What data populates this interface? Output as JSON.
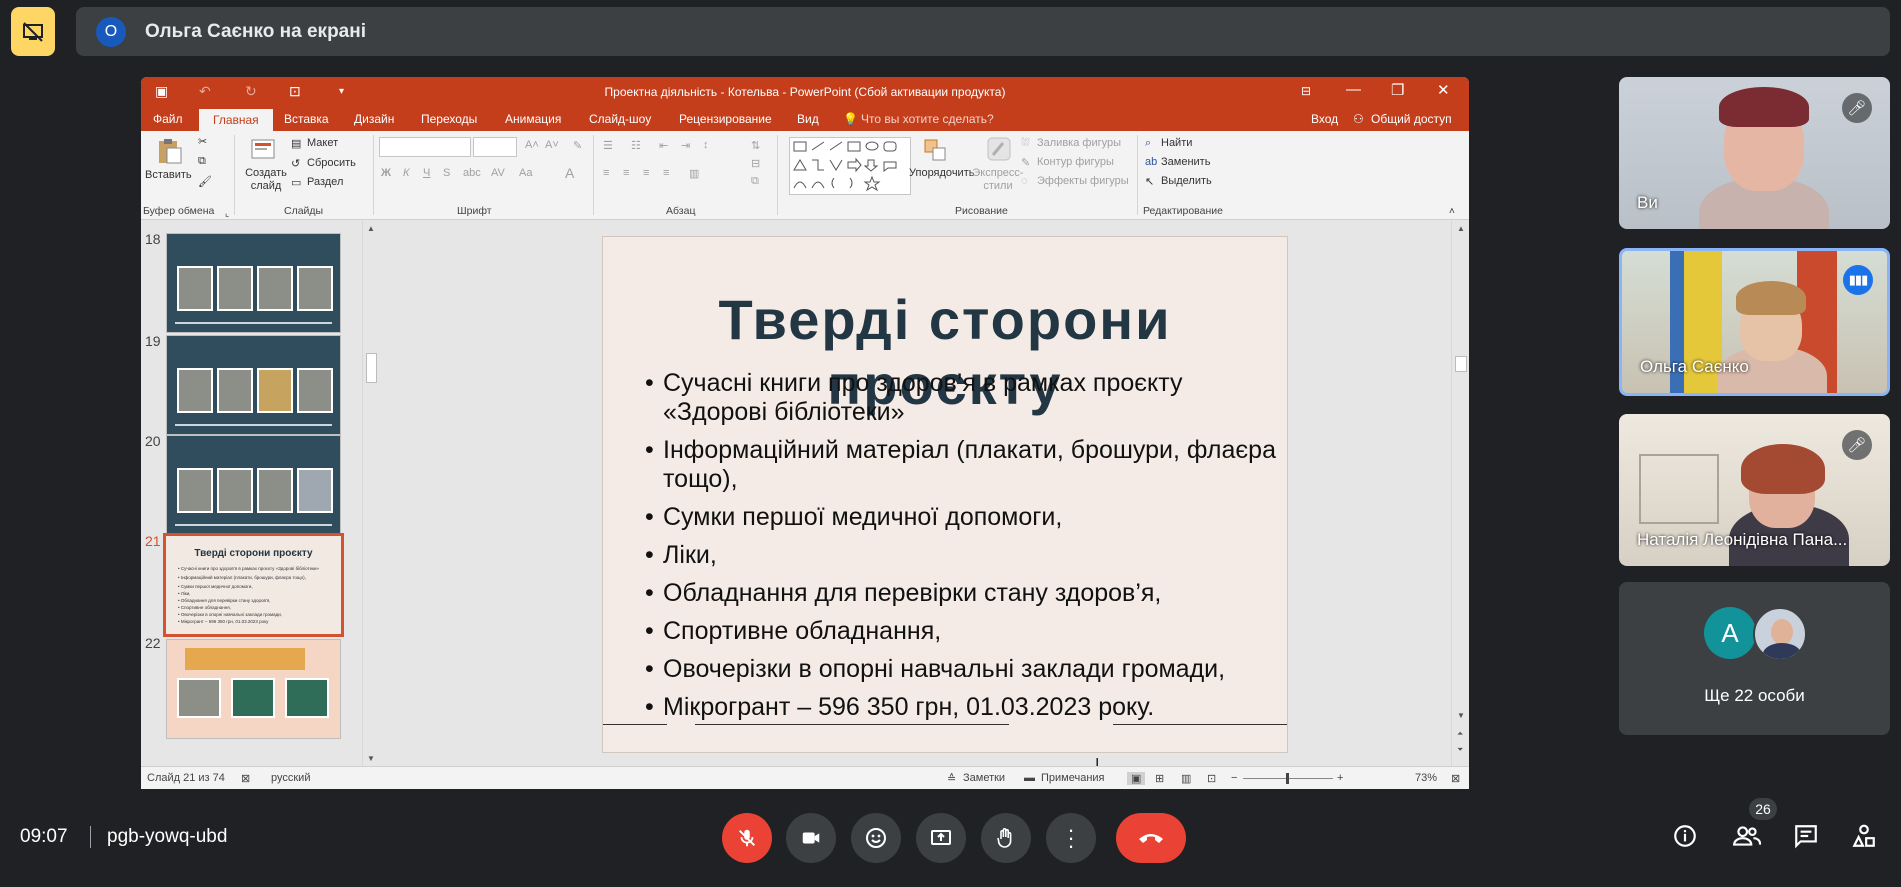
{
  "meeting": {
    "presenter_initial": "О",
    "presenter_banner": "Ольга Саєнко на екрані",
    "time": "09:07",
    "code": "pgb-yowq-ubd",
    "participants_count": "26"
  },
  "ppt": {
    "window_title": "Проектна діяльність - Котельва - PowerPoint (Сбой активации продукта)",
    "tabs": [
      "Файл",
      "Главная",
      "Вставка",
      "Дизайн",
      "Переходы",
      "Анимация",
      "Слайд-шоу",
      "Рецензирование",
      "Вид"
    ],
    "tell_me": "Что вы хотите сделать?",
    "sign_in": "Вход",
    "share": "Общий доступ",
    "ribbon": {
      "paste": "Вставить",
      "clipboard_group": "Буфер обмена",
      "new_slide": "Создать слайд",
      "layout": "Макет",
      "reset": "Сбросить",
      "section": "Раздел",
      "slides_group": "Слайды",
      "font_group": "Шрифт",
      "paragraph_group": "Абзац",
      "arrange": "Упорядочить",
      "quick_styles": "Экспресс-стили",
      "shape_fill": "Заливка фигуры",
      "shape_outline": "Контур фигуры",
      "shape_effects": "Эффекты фигуры",
      "drawing_group": "Рисование",
      "find": "Найти",
      "replace": "Заменить",
      "select": "Выделить",
      "editing_group": "Редактирование"
    },
    "thumbnails": {
      "numbers": [
        "18",
        "19",
        "20",
        "21",
        "22"
      ],
      "thumb21_title": "Тверді сторони проєкту",
      "thumb21_lines": [
        "• Сучасні книги про здоров’я в рамках проєкту «Здорові бібліотеки»",
        "• Інформаційний матеріал (плакати, брошури, флаєра тощо),",
        "• Сумки першої медичної допомоги,",
        "• Ліки,",
        "• Обладнання для перевірки стану здоров’я,",
        "• Спортивне обладнання,",
        "• Овочерізки в опорні навчальні заклади громади,",
        "• Мікрогрант – 596 350 грн, 01.03.2023 року"
      ]
    },
    "slide": {
      "title": "Тверді сторони проєкту",
      "bullets": [
        "Сучасні книги про здоров’я в рамках проєкту «Здорові бібліотеки»",
        "Інформаційний матеріал (плакати, брошури, флаєра тощо),",
        "Сумки першої медичної допомоги,",
        "Ліки,",
        "Обладнання для перевірки стану здоров’я,",
        "Спортивне обладнання,",
        "Овочерізки в опорні навчальні заклади громади,",
        "Мікрогрант – 596 350 грн, 01.03.2023 року."
      ]
    },
    "status": {
      "slide_of": "Слайд 21 из 74",
      "language": "русский",
      "notes": "Заметки",
      "comments": "Примечания",
      "zoom": "73%"
    }
  },
  "participants": [
    {
      "name": "Ви",
      "muted": true
    },
    {
      "name": "Ольга Саєнко",
      "speaking": true
    },
    {
      "name": "Наталія Леонідівна Пана...",
      "muted": true
    }
  ],
  "more_tile": {
    "avatar_letter": "А",
    "label": "Ще 22 особи"
  },
  "colors": {
    "ppt_accent": "#c43e1c",
    "end_call": "#ea4335",
    "speaking_border": "#8ab4f8",
    "present_icon_bg": "#fdd663"
  }
}
